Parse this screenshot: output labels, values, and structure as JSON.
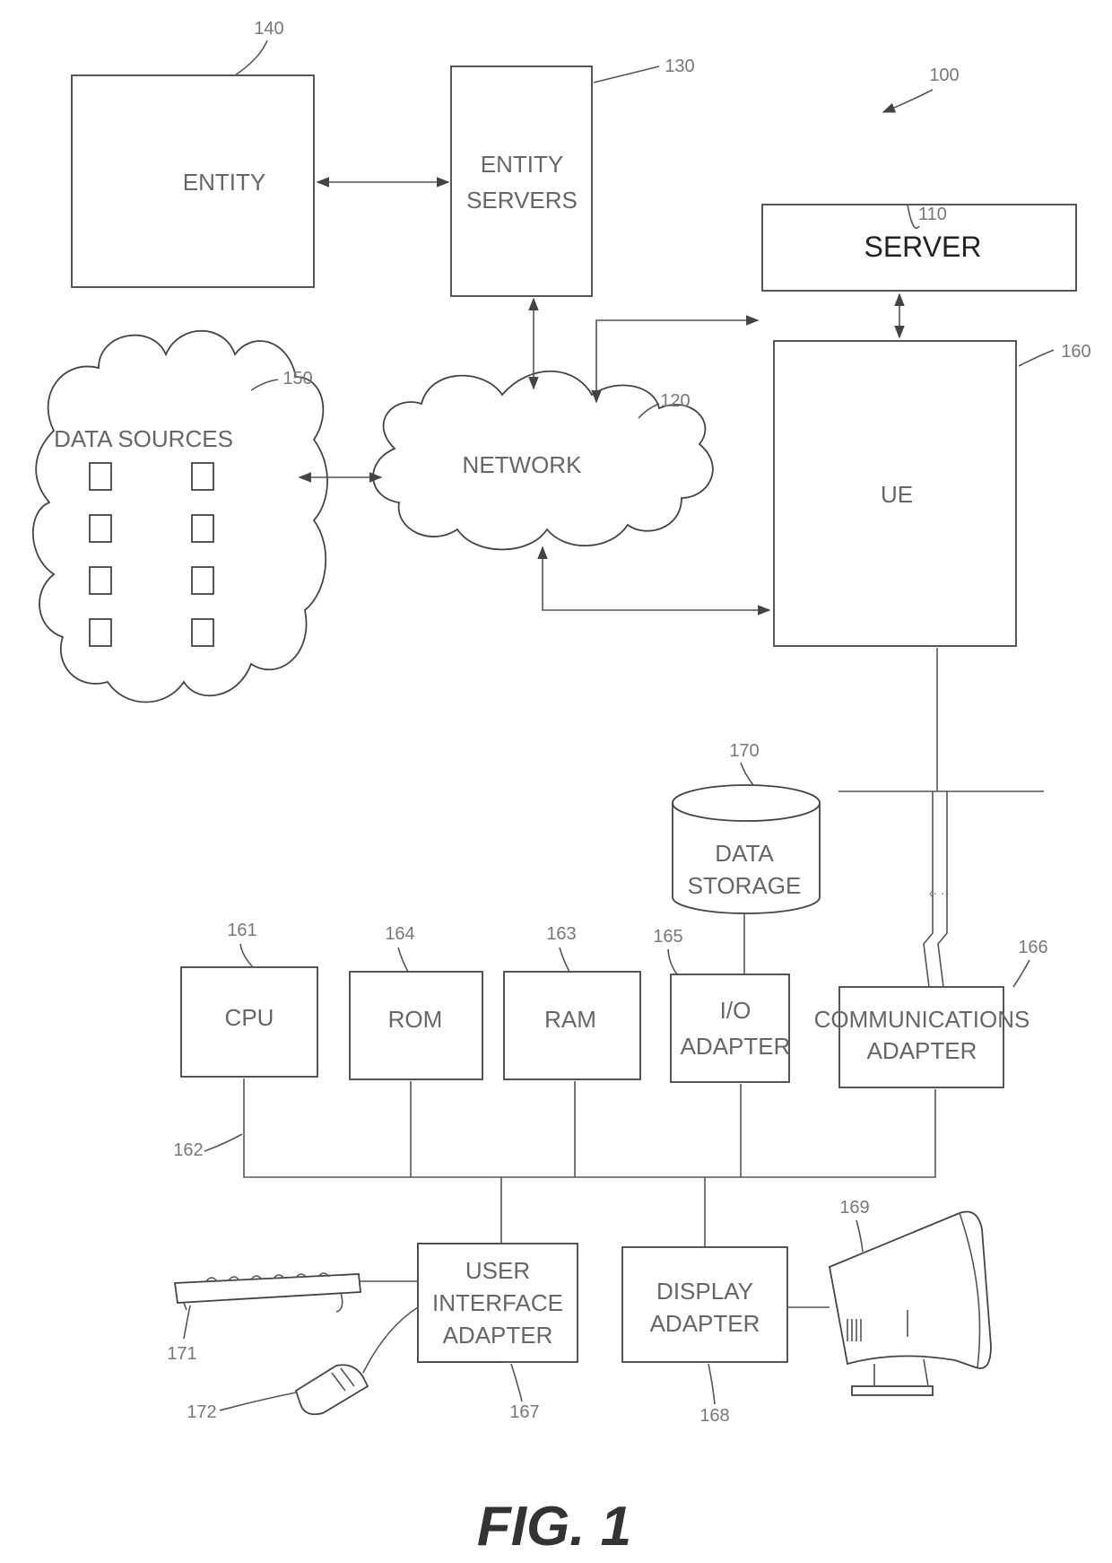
{
  "figure": {
    "system_ref": "100",
    "caption": "FIG. 1"
  },
  "blocks": {
    "entity": {
      "label": "ENTITY",
      "ref": "140"
    },
    "entity_servers": {
      "label_line1": "ENTITY",
      "label_line2": "SERVERS",
      "ref": "130"
    },
    "server": {
      "label": "SERVER",
      "ref": "110"
    },
    "data_sources": {
      "label": "DATA SOURCES",
      "ref": "150"
    },
    "network": {
      "label": "NETWORK",
      "ref": "120"
    },
    "ue": {
      "label": "UE",
      "ref": "160"
    },
    "data_storage": {
      "label_line1": "DATA",
      "label_line2": "STORAGE",
      "ref": "170"
    },
    "cpu": {
      "label": "CPU",
      "ref": "161"
    },
    "rom": {
      "label": "ROM",
      "ref": "164"
    },
    "ram": {
      "label": "RAM",
      "ref": "163"
    },
    "io_adapter": {
      "label_line1": "I/O",
      "label_line2": "ADAPTER",
      "ref": "165"
    },
    "comm_adapter": {
      "label_line1": "COMMUNICATIONS",
      "label_line2": "ADAPTER",
      "ref": "166"
    },
    "bus": {
      "ref": "162"
    },
    "ui_adapter": {
      "label_line1": "USER",
      "label_line2": "INTERFACE",
      "label_line3": "ADAPTER",
      "ref": "167"
    },
    "display_adapter": {
      "label_line1": "DISPLAY",
      "label_line2": "ADAPTER",
      "ref": "168"
    },
    "display": {
      "ref": "169"
    },
    "keyboard": {
      "ref": "171"
    },
    "mouse": {
      "ref": "172"
    }
  }
}
